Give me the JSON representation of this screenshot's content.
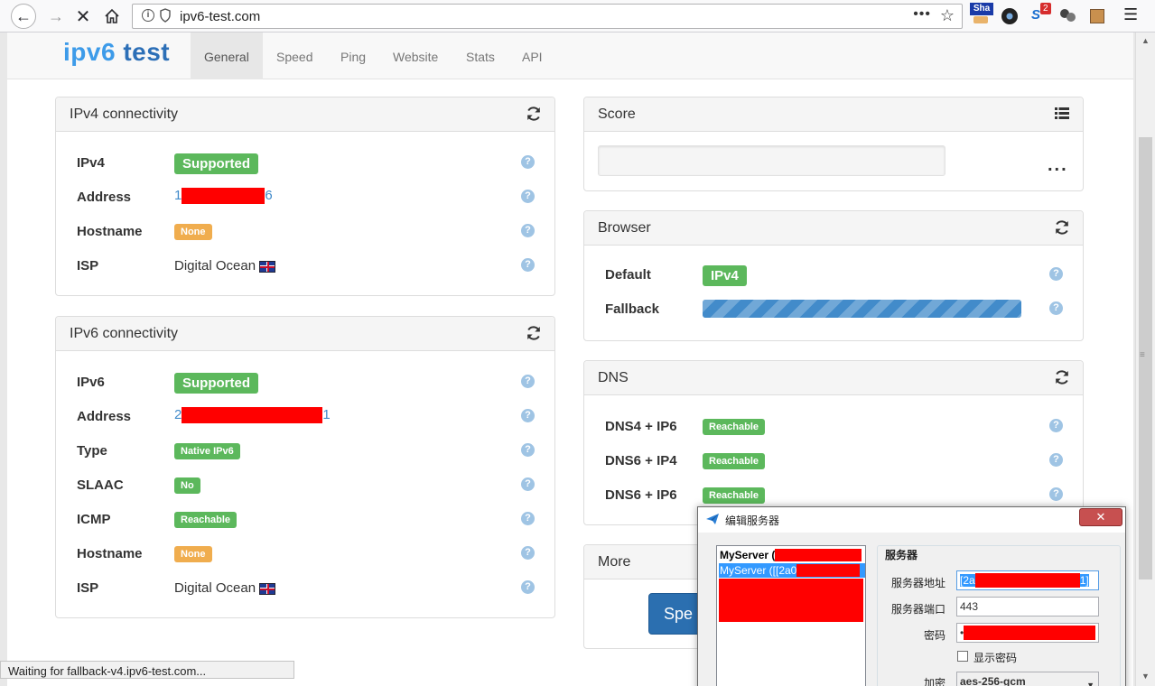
{
  "browser": {
    "url": "ipv6-test.com",
    "ext_sha_label": "Sha",
    "ext_badge": "2",
    "status_text": "Waiting for fallback-v4.ipv6-test.com..."
  },
  "site": {
    "brand_a": "ipv6",
    "brand_b": "test",
    "tabs": [
      "General",
      "Speed",
      "Ping",
      "Website",
      "Stats",
      "API"
    ],
    "active_tab": "General"
  },
  "ipv4": {
    "title": "IPv4 connectivity",
    "rows": [
      {
        "label": "IPv4",
        "value": "Supported"
      },
      {
        "label": "Address",
        "prefix": "1",
        "suffix": "6"
      },
      {
        "label": "Hostname",
        "value": "None"
      },
      {
        "label": "ISP",
        "value": "Digital Ocean"
      }
    ]
  },
  "ipv6": {
    "title": "IPv6 connectivity",
    "rows": [
      {
        "label": "IPv6",
        "value": "Supported"
      },
      {
        "label": "Address",
        "prefix": "2",
        "suffix": "1"
      },
      {
        "label": "Type",
        "value": "Native IPv6"
      },
      {
        "label": "SLAAC",
        "value": "No"
      },
      {
        "label": "ICMP",
        "value": "Reachable"
      },
      {
        "label": "Hostname",
        "value": "None"
      },
      {
        "label": "ISP",
        "value": "Digital Ocean"
      }
    ]
  },
  "score": {
    "title": "Score",
    "loading": "..."
  },
  "browser_panel": {
    "title": "Browser",
    "default_label": "Default",
    "default_value": "IPv4",
    "fallback_label": "Fallback",
    "fallback_progress": 1.0
  },
  "dns": {
    "title": "DNS",
    "rows": [
      {
        "label": "DNS4 + IP6",
        "value": "Reachable"
      },
      {
        "label": "DNS6 + IP4",
        "value": "Reachable"
      },
      {
        "label": "DNS6 + IP6",
        "value": "Reachable"
      }
    ]
  },
  "more": {
    "title": "More",
    "button": "Spe"
  },
  "help_glyph": "?",
  "dialog": {
    "title": "编辑服务器",
    "close": "✕",
    "servers": [
      "MyServer (",
      "MyServer ([[2a0"
    ],
    "group_title": "服务器",
    "address_label": "服务器地址",
    "address_value": "[2a",
    "address_tail": "1]",
    "port_label": "服务器端口",
    "port_value": "443",
    "password_label": "密码",
    "password_value": "•",
    "show_password": "显示密码",
    "encryption_label": "加密",
    "encryption_value": "aes-256-gcm"
  },
  "colors": {
    "success": "#5cb85c",
    "warning": "#f0ad4e",
    "primary": "#428bca",
    "redaction": "#ff0000"
  }
}
